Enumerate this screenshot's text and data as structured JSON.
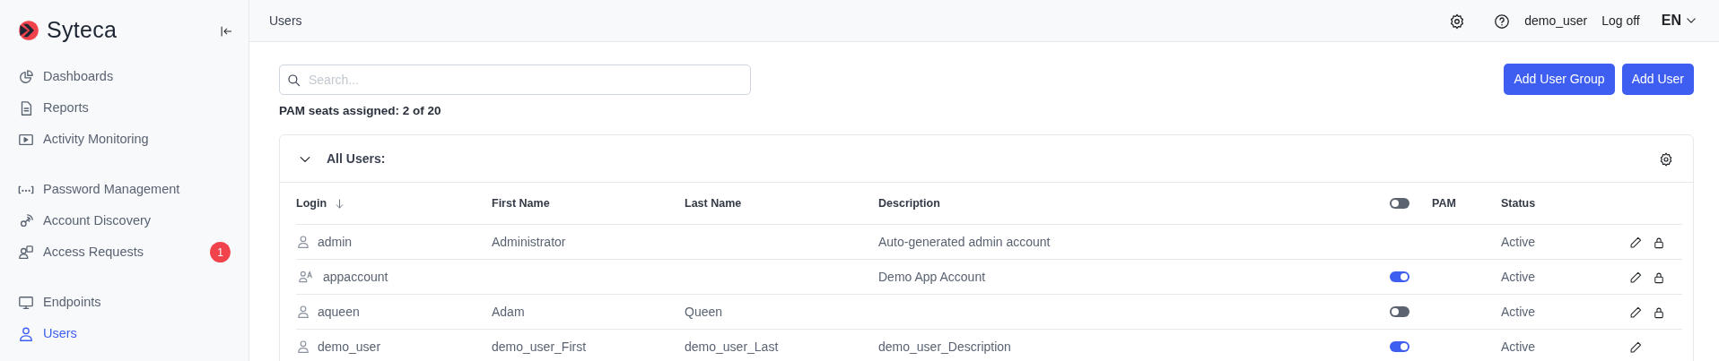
{
  "sidebar": {
    "brand": "Syteca",
    "groups": [
      {
        "items": [
          {
            "label": "Dashboards",
            "selected": false
          },
          {
            "label": "Reports",
            "selected": false
          },
          {
            "label": "Activity Monitoring",
            "selected": false
          }
        ]
      },
      {
        "items": [
          {
            "label": "Password Management",
            "selected": false
          },
          {
            "label": "Account Discovery",
            "selected": false
          },
          {
            "label": "Access Requests",
            "selected": false,
            "badge": "1"
          }
        ]
      },
      {
        "items": [
          {
            "label": "Endpoints",
            "selected": false
          },
          {
            "label": "Users",
            "selected": true
          }
        ]
      }
    ]
  },
  "header": {
    "title": "Users",
    "user": "demo_user",
    "logoff": "Log off",
    "language": "EN"
  },
  "search": {
    "placeholder": "Search..."
  },
  "buttons": [
    "Add User Group",
    "Add User"
  ],
  "seats": "PAM seats assigned: 2 of 20",
  "panel": {
    "title": "All Users:",
    "expanded": true
  },
  "table": {
    "columns": [
      "Login",
      "First Name",
      "Last Name",
      "Description",
      "PAM",
      "Status"
    ],
    "pam_header_on": false,
    "rows": [
      {
        "kind": "user",
        "login": "admin",
        "first": "Administrator",
        "last": "",
        "description": "Auto-generated admin account",
        "status": "Active",
        "lock": true
      },
      {
        "kind": "app",
        "login": "appaccount",
        "first": "",
        "last": "",
        "description": "Demo App Account",
        "pam": true,
        "status": "Active",
        "lock": true
      },
      {
        "kind": "user",
        "login": "aqueen",
        "first": "Adam",
        "last": "Queen",
        "description": "",
        "pam": false,
        "status": "Active",
        "lock": true
      },
      {
        "kind": "user",
        "login": "demo_user",
        "first": "demo_user_First",
        "last": "demo_user_Last",
        "description": "demo_user_Description",
        "pam": true,
        "status": "Active",
        "lock": false
      }
    ]
  }
}
